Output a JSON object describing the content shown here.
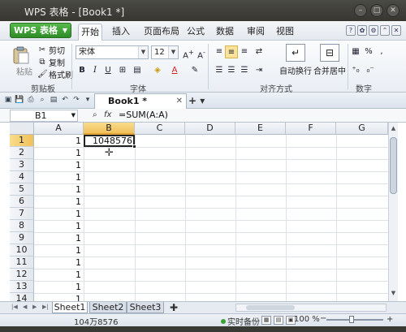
{
  "window": {
    "title": "WPS 表格 - [Book1 *]"
  },
  "menu": {
    "wps_label": "WPS 表格",
    "tabs": [
      "开始",
      "插入",
      "页面布局",
      "公式",
      "数据",
      "审阅",
      "视图"
    ],
    "active_tab": "开始"
  },
  "ribbon": {
    "clipboard": {
      "paste": "粘贴",
      "cut": "剪切",
      "copy": "复制",
      "format_painter": "格式刷",
      "group": "剪贴板"
    },
    "font": {
      "name": "宋体",
      "size": "12",
      "group": "字体"
    },
    "alignment": {
      "wrap": "自动换行",
      "merge": "合并居中",
      "group": "对齐方式"
    },
    "number": {
      "percent": "%",
      "group": "数字"
    }
  },
  "doc_tab": {
    "name": "Book1 *"
  },
  "formula_bar": {
    "name_box": "B1",
    "formula": "=SUM(A:A)"
  },
  "columns": [
    "A",
    "B",
    "C",
    "D",
    "E",
    "F",
    "G"
  ],
  "rows": [
    "1",
    "2",
    "3",
    "4",
    "5",
    "6",
    "7",
    "8",
    "9",
    "10",
    "11",
    "12",
    "13",
    "14"
  ],
  "col_a_values": [
    "1",
    "1",
    "1",
    "1",
    "1",
    "1",
    "1",
    "1",
    "1",
    "1",
    "1",
    "1",
    "1",
    "1"
  ],
  "b1_value": "1048576",
  "sheets": [
    "Sheet1",
    "Sheet2",
    "Sheet3"
  ],
  "active_sheet": "Sheet1",
  "status": {
    "sum": "104万8576",
    "backup": "实时备份",
    "zoom": "100 %"
  },
  "colors": {
    "accent_green": "#2e8c27",
    "selection": "#f1c15a"
  }
}
